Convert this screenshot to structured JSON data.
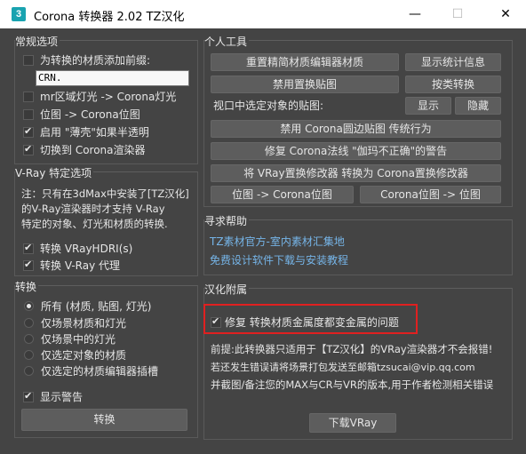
{
  "window": {
    "title": "Corona 转换器 2.02  TZ汉化",
    "icon_text": "3",
    "minimize": "—",
    "maximize": "☐",
    "close": "✕"
  },
  "general": {
    "title": "常规选项",
    "prefix_label": "为转换的材质添加前缀:",
    "prefix_value": "CRN.",
    "mr_area_label": "mr区域灯光 -> Corona灯光",
    "bitmap_label": "位图 -> Corona位图",
    "thin_label": "启用 \"薄壳\"如果半透明",
    "switch_label": "切换到 Corona渲染器"
  },
  "vray": {
    "title": "V-Ray 特定选项",
    "note1": "注：只有在3dMax中安装了[TZ汉化]",
    "note2": "的V-Ray渲染器时才支持 V-Ray",
    "note3": "特定的对象、灯光和材质的转换.",
    "hdri_label": "转换 VRayHDRI(s)",
    "proxy_label": "转换 V-Ray 代理"
  },
  "convert": {
    "title": "转换",
    "options": [
      "所有 (材质, 贴图, 灯光)",
      "仅场景材质和灯光",
      "仅场景中的灯光",
      "仅选定对象的材质",
      "仅选定的材质编辑器插槽"
    ],
    "warning_label": "显示警告",
    "button": "转换"
  },
  "tools": {
    "title": "个人工具",
    "reset_mat_editor": "重置精简材质编辑器材质",
    "show_stats": "显示统计信息",
    "disable_displacement": "禁用置换贴图",
    "convert_by_class": "按类转换",
    "viewport_label": "视口中选定对象的贴图:",
    "show": "显示",
    "hide": "隐藏",
    "disable_round_corners": "禁用 Corona圆边贴图 传统行为",
    "fix_normals": "修复 Corona法线 \"伽玛不正确\"的警告",
    "vray_disp_to_corona": "将 VRay置换修改器 转换为 Corona置换修改器",
    "bitmap_to_corona": "位图 -> Corona位图",
    "corona_to_bitmap": "Corona位图 -> 位图"
  },
  "help": {
    "title": "寻求帮助",
    "link1": "TZ素材官方-室内素材汇集地",
    "link2": "免费设计软件下载与安装教程"
  },
  "addon": {
    "title": "汉化附属",
    "fix_metal_label": "修复 转换材质金属度都变金属的问题",
    "note1": "前提:此转换器只适用于【TZ汉化】的VRay渲染器才不会报错!",
    "note2": "若还发生错误请将场景打包发送至邮箱tzsucai@vip.qq.com",
    "note3": "并截图/备注您的MAX与CR与VR的版本,用于作者检测相关错误",
    "download_vray": "下载VRay"
  },
  "colors": {
    "background": "#444444",
    "button": "#5d5d5d",
    "link": "#76b5e8",
    "highlight": "#e02020"
  }
}
